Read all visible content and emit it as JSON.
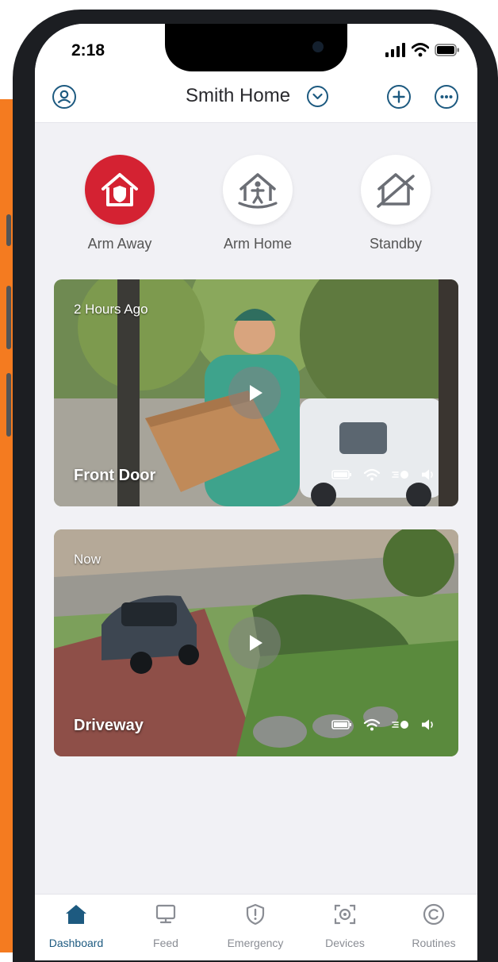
{
  "status_bar": {
    "time": "2:18"
  },
  "header": {
    "title": "Smith Home"
  },
  "modes": [
    {
      "label": "Arm Away",
      "active": true
    },
    {
      "label": "Arm Home",
      "active": false
    },
    {
      "label": "Standby",
      "active": false
    }
  ],
  "cameras": [
    {
      "time_label": "2 Hours Ago",
      "name": "Front Door"
    },
    {
      "time_label": "Now",
      "name": "Driveway"
    }
  ],
  "tabs": [
    {
      "label": "Dashboard",
      "active": true
    },
    {
      "label": "Feed",
      "active": false
    },
    {
      "label": "Emergency",
      "active": false
    },
    {
      "label": "Devices",
      "active": false
    },
    {
      "label": "Routines",
      "active": false
    }
  ],
  "colors": {
    "accent": "#1d5a80",
    "arm_away_red": "#d42232",
    "background_orange": "#f47b20"
  },
  "icons": {
    "header_left": "user-icon",
    "header_title": "chevron-down-icon",
    "header_right": [
      "add-icon",
      "more-icon"
    ],
    "modes": [
      "shield-house-icon",
      "person-house-icon",
      "slashed-house-icon"
    ],
    "camera_status": [
      "battery-icon",
      "wifi-icon",
      "motion-icon",
      "speaker-icon"
    ],
    "tabs": [
      "house-icon",
      "monitor-icon",
      "shield-alert-icon",
      "camera-icon",
      "routines-icon"
    ]
  }
}
